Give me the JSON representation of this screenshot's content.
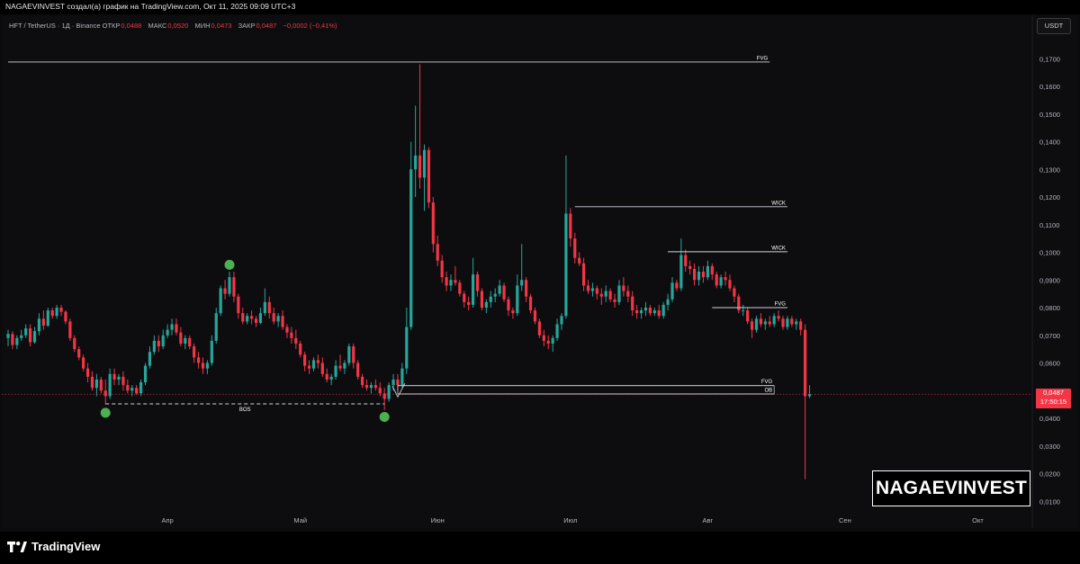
{
  "header": {
    "title": "NAGAEVINVEST создал(а) график на TradingView.com, Окт 11, 2025 09:09 UTC+3"
  },
  "symbol": {
    "name": "HFT / TetherUS · 1Д · Binance",
    "open_label": "ОТКР",
    "open_value": "0,0488",
    "high_label": "МАКС",
    "high_value": "0,0520",
    "low_label": "МИН",
    "low_value": "0,0473",
    "close_label": "ЗАКР",
    "close_value": "0,0487",
    "change": "−0,0002 (−0,41%)"
  },
  "currency_button": "USDT",
  "price_tag": {
    "price": "0,0487",
    "countdown": "17:50:15"
  },
  "watermark": "NAGAEVINVEST",
  "footer": {
    "brand": "TradingView"
  },
  "colors": {
    "up": "#26a69a",
    "down": "#f23645",
    "marker": "#4caf50",
    "background": "#0d0d10",
    "line": "#d1d4dc"
  },
  "chart_data": {
    "type": "candlestick",
    "title": "",
    "xlabel": "",
    "ylabel": "",
    "ylim": [
      0,
      0.175
    ],
    "y_ticks": [
      "0,0100",
      "0,0200",
      "0,0300",
      "0,0400",
      "0,0500",
      "0,0600",
      "0,0700",
      "0,0800",
      "0,0900",
      "0,1000",
      "0,1100",
      "0,1200",
      "0,1300",
      "0,1400",
      "0,1500",
      "0,1600",
      "0,1700"
    ],
    "y_tick_values": [
      0.01,
      0.02,
      0.03,
      0.04,
      0.05,
      0.06,
      0.07,
      0.08,
      0.09,
      0.1,
      0.11,
      0.12,
      0.13,
      0.14,
      0.15,
      0.16,
      0.17
    ],
    "x_ticks": [
      {
        "label": "Апр",
        "index": 36
      },
      {
        "label": "Май",
        "index": 66
      },
      {
        "label": "Июн",
        "index": 97
      },
      {
        "label": "Июл",
        "index": 127
      },
      {
        "label": "Авг",
        "index": 158
      },
      {
        "label": "Сен",
        "index": 189
      },
      {
        "label": "Окт",
        "index": 219
      }
    ],
    "candles": [
      [
        0.069,
        0.072,
        0.066,
        0.0705
      ],
      [
        0.0705,
        0.0715,
        0.065,
        0.0665
      ],
      [
        0.0665,
        0.07,
        0.065,
        0.069
      ],
      [
        0.069,
        0.072,
        0.068,
        0.07
      ],
      [
        0.07,
        0.074,
        0.069,
        0.0725
      ],
      [
        0.0725,
        0.074,
        0.066,
        0.0675
      ],
      [
        0.0675,
        0.073,
        0.067,
        0.0715
      ],
      [
        0.0715,
        0.078,
        0.07,
        0.076
      ],
      [
        0.076,
        0.079,
        0.072,
        0.0735
      ],
      [
        0.0735,
        0.08,
        0.073,
        0.079
      ],
      [
        0.079,
        0.08,
        0.076,
        0.077
      ],
      [
        0.077,
        0.081,
        0.076,
        0.08
      ],
      [
        0.08,
        0.081,
        0.077,
        0.0785
      ],
      [
        0.0785,
        0.079,
        0.074,
        0.075
      ],
      [
        0.075,
        0.076,
        0.068,
        0.069
      ],
      [
        0.069,
        0.07,
        0.064,
        0.065
      ],
      [
        0.065,
        0.066,
        0.061,
        0.062
      ],
      [
        0.062,
        0.063,
        0.057,
        0.058
      ],
      [
        0.058,
        0.06,
        0.053,
        0.055
      ],
      [
        0.055,
        0.057,
        0.05,
        0.051
      ],
      [
        0.051,
        0.056,
        0.048,
        0.054
      ],
      [
        0.054,
        0.055,
        0.049,
        0.05
      ],
      [
        0.05,
        0.054,
        0.045,
        0.048
      ],
      [
        0.048,
        0.058,
        0.047,
        0.056
      ],
      [
        0.056,
        0.058,
        0.052,
        0.054
      ],
      [
        0.054,
        0.056,
        0.052,
        0.055
      ],
      [
        0.055,
        0.057,
        0.05,
        0.052
      ],
      [
        0.052,
        0.054,
        0.049,
        0.05
      ],
      [
        0.05,
        0.052,
        0.048,
        0.051
      ],
      [
        0.051,
        0.052,
        0.0485,
        0.049
      ],
      [
        0.049,
        0.054,
        0.048,
        0.053
      ],
      [
        0.053,
        0.06,
        0.052,
        0.059
      ],
      [
        0.059,
        0.066,
        0.058,
        0.064
      ],
      [
        0.064,
        0.07,
        0.063,
        0.068
      ],
      [
        0.068,
        0.07,
        0.064,
        0.066
      ],
      [
        0.066,
        0.072,
        0.065,
        0.07
      ],
      [
        0.07,
        0.074,
        0.069,
        0.072
      ],
      [
        0.072,
        0.076,
        0.07,
        0.074
      ],
      [
        0.074,
        0.076,
        0.07,
        0.071
      ],
      [
        0.071,
        0.073,
        0.066,
        0.067
      ],
      [
        0.067,
        0.07,
        0.065,
        0.069
      ],
      [
        0.069,
        0.07,
        0.065,
        0.066
      ],
      [
        0.066,
        0.067,
        0.06,
        0.062
      ],
      [
        0.062,
        0.064,
        0.058,
        0.06
      ],
      [
        0.06,
        0.062,
        0.056,
        0.058
      ],
      [
        0.058,
        0.061,
        0.056,
        0.06
      ],
      [
        0.06,
        0.07,
        0.059,
        0.068
      ],
      [
        0.068,
        0.08,
        0.067,
        0.078
      ],
      [
        0.078,
        0.088,
        0.077,
        0.087
      ],
      [
        0.087,
        0.09,
        0.083,
        0.085
      ],
      [
        0.085,
        0.093,
        0.084,
        0.091
      ],
      [
        0.091,
        0.093,
        0.082,
        0.084
      ],
      [
        0.084,
        0.085,
        0.076,
        0.078
      ],
      [
        0.078,
        0.08,
        0.074,
        0.075
      ],
      [
        0.075,
        0.078,
        0.074,
        0.077
      ],
      [
        0.077,
        0.079,
        0.074,
        0.076
      ],
      [
        0.076,
        0.077,
        0.073,
        0.0745
      ],
      [
        0.0745,
        0.08,
        0.074,
        0.078
      ],
      [
        0.078,
        0.087,
        0.077,
        0.082
      ],
      [
        0.082,
        0.084,
        0.076,
        0.078
      ],
      [
        0.078,
        0.08,
        0.074,
        0.075
      ],
      [
        0.075,
        0.078,
        0.073,
        0.077
      ],
      [
        0.077,
        0.079,
        0.072,
        0.073
      ],
      [
        0.073,
        0.074,
        0.069,
        0.071
      ],
      [
        0.071,
        0.073,
        0.067,
        0.069
      ],
      [
        0.069,
        0.072,
        0.065,
        0.067
      ],
      [
        0.067,
        0.068,
        0.062,
        0.063
      ],
      [
        0.063,
        0.064,
        0.057,
        0.059
      ],
      [
        0.059,
        0.061,
        0.056,
        0.058
      ],
      [
        0.058,
        0.062,
        0.057,
        0.061
      ],
      [
        0.061,
        0.063,
        0.058,
        0.06
      ],
      [
        0.06,
        0.062,
        0.055,
        0.056
      ],
      [
        0.056,
        0.058,
        0.053,
        0.054
      ],
      [
        0.054,
        0.056,
        0.052,
        0.055
      ],
      [
        0.055,
        0.061,
        0.054,
        0.059
      ],
      [
        0.059,
        0.063,
        0.057,
        0.058
      ],
      [
        0.058,
        0.061,
        0.056,
        0.06
      ],
      [
        0.06,
        0.067,
        0.059,
        0.066
      ],
      [
        0.066,
        0.067,
        0.058,
        0.06
      ],
      [
        0.06,
        0.061,
        0.054,
        0.055
      ],
      [
        0.055,
        0.056,
        0.051,
        0.052
      ],
      [
        0.052,
        0.054,
        0.05,
        0.051
      ],
      [
        0.051,
        0.053,
        0.049,
        0.052
      ],
      [
        0.052,
        0.054,
        0.05,
        0.051
      ],
      [
        0.051,
        0.053,
        0.048,
        0.049
      ],
      [
        0.049,
        0.051,
        0.043,
        0.047
      ],
      [
        0.047,
        0.053,
        0.046,
        0.052
      ],
      [
        0.052,
        0.056,
        0.05,
        0.054
      ],
      [
        0.054,
        0.056,
        0.05,
        0.052
      ],
      [
        0.052,
        0.06,
        0.051,
        0.058
      ],
      [
        0.058,
        0.08,
        0.056,
        0.073
      ],
      [
        0.073,
        0.14,
        0.072,
        0.13
      ],
      [
        0.13,
        0.153,
        0.12,
        0.135
      ],
      [
        0.135,
        0.168,
        0.123,
        0.127
      ],
      [
        0.127,
        0.139,
        0.115,
        0.137
      ],
      [
        0.137,
        0.138,
        0.116,
        0.118
      ],
      [
        0.118,
        0.12,
        0.1,
        0.103
      ],
      [
        0.103,
        0.106,
        0.095,
        0.097
      ],
      [
        0.097,
        0.099,
        0.089,
        0.091
      ],
      [
        0.091,
        0.093,
        0.086,
        0.088
      ],
      [
        0.088,
        0.092,
        0.086,
        0.09
      ],
      [
        0.09,
        0.095,
        0.088,
        0.089
      ],
      [
        0.089,
        0.09,
        0.084,
        0.085
      ],
      [
        0.085,
        0.086,
        0.08,
        0.082
      ],
      [
        0.082,
        0.084,
        0.079,
        0.081
      ],
      [
        0.081,
        0.098,
        0.08,
        0.092
      ],
      [
        0.092,
        0.093,
        0.084,
        0.086
      ],
      [
        0.086,
        0.087,
        0.079,
        0.08
      ],
      [
        0.08,
        0.083,
        0.078,
        0.082
      ],
      [
        0.082,
        0.086,
        0.08,
        0.084
      ],
      [
        0.084,
        0.087,
        0.082,
        0.085
      ],
      [
        0.085,
        0.09,
        0.084,
        0.088
      ],
      [
        0.088,
        0.089,
        0.082,
        0.083
      ],
      [
        0.083,
        0.084,
        0.077,
        0.079
      ],
      [
        0.079,
        0.08,
        0.076,
        0.078
      ],
      [
        0.078,
        0.092,
        0.077,
        0.088
      ],
      [
        0.088,
        0.103,
        0.086,
        0.09
      ],
      [
        0.09,
        0.091,
        0.082,
        0.084
      ],
      [
        0.084,
        0.085,
        0.078,
        0.079
      ],
      [
        0.079,
        0.08,
        0.074,
        0.075
      ],
      [
        0.075,
        0.076,
        0.069,
        0.07
      ],
      [
        0.07,
        0.072,
        0.066,
        0.068
      ],
      [
        0.068,
        0.07,
        0.065,
        0.067
      ],
      [
        0.067,
        0.07,
        0.064,
        0.069
      ],
      [
        0.069,
        0.076,
        0.068,
        0.074
      ],
      [
        0.074,
        0.078,
        0.072,
        0.077
      ],
      [
        0.077,
        0.135,
        0.076,
        0.114
      ],
      [
        0.114,
        0.116,
        0.102,
        0.105
      ],
      [
        0.105,
        0.107,
        0.096,
        0.098
      ],
      [
        0.098,
        0.1,
        0.095,
        0.096
      ],
      [
        0.096,
        0.098,
        0.086,
        0.088
      ],
      [
        0.088,
        0.09,
        0.085,
        0.086
      ],
      [
        0.086,
        0.089,
        0.084,
        0.087
      ],
      [
        0.087,
        0.088,
        0.083,
        0.085
      ],
      [
        0.085,
        0.087,
        0.081,
        0.084
      ],
      [
        0.084,
        0.088,
        0.082,
        0.086
      ],
      [
        0.086,
        0.087,
        0.082,
        0.083
      ],
      [
        0.083,
        0.085,
        0.08,
        0.082
      ],
      [
        0.082,
        0.09,
        0.081,
        0.088
      ],
      [
        0.088,
        0.091,
        0.084,
        0.086
      ],
      [
        0.086,
        0.088,
        0.082,
        0.084
      ],
      [
        0.084,
        0.086,
        0.077,
        0.079
      ],
      [
        0.079,
        0.081,
        0.076,
        0.078
      ],
      [
        0.078,
        0.08,
        0.076,
        0.079
      ],
      [
        0.079,
        0.082,
        0.077,
        0.08
      ],
      [
        0.08,
        0.081,
        0.077,
        0.078
      ],
      [
        0.078,
        0.08,
        0.077,
        0.079
      ],
      [
        0.079,
        0.081,
        0.076,
        0.077
      ],
      [
        0.077,
        0.082,
        0.076,
        0.081
      ],
      [
        0.081,
        0.085,
        0.079,
        0.083
      ],
      [
        0.083,
        0.091,
        0.082,
        0.089
      ],
      [
        0.089,
        0.09,
        0.086,
        0.087
      ],
      [
        0.087,
        0.105,
        0.086,
        0.099
      ],
      [
        0.099,
        0.101,
        0.093,
        0.095
      ],
      [
        0.095,
        0.097,
        0.092,
        0.094
      ],
      [
        0.094,
        0.096,
        0.088,
        0.09
      ],
      [
        0.09,
        0.095,
        0.088,
        0.093
      ],
      [
        0.093,
        0.095,
        0.089,
        0.091
      ],
      [
        0.091,
        0.097,
        0.09,
        0.095
      ],
      [
        0.095,
        0.096,
        0.09,
        0.092
      ],
      [
        0.092,
        0.093,
        0.087,
        0.088
      ],
      [
        0.088,
        0.092,
        0.087,
        0.091
      ],
      [
        0.091,
        0.093,
        0.088,
        0.09
      ],
      [
        0.09,
        0.092,
        0.086,
        0.087
      ],
      [
        0.087,
        0.088,
        0.082,
        0.084
      ],
      [
        0.084,
        0.085,
        0.078,
        0.079
      ],
      [
        0.079,
        0.081,
        0.077,
        0.079
      ],
      [
        0.079,
        0.08,
        0.074,
        0.075
      ],
      [
        0.075,
        0.076,
        0.069,
        0.072
      ],
      [
        0.072,
        0.077,
        0.071,
        0.076
      ],
      [
        0.076,
        0.078,
        0.073,
        0.074
      ],
      [
        0.074,
        0.076,
        0.072,
        0.075
      ],
      [
        0.075,
        0.077,
        0.073,
        0.074
      ],
      [
        0.074,
        0.078,
        0.073,
        0.077
      ],
      [
        0.077,
        0.079,
        0.075,
        0.076
      ],
      [
        0.076,
        0.077,
        0.072,
        0.073
      ],
      [
        0.073,
        0.077,
        0.072,
        0.076
      ],
      [
        0.076,
        0.077,
        0.073,
        0.074
      ],
      [
        0.074,
        0.076,
        0.072,
        0.075
      ],
      [
        0.075,
        0.076,
        0.07,
        0.072
      ],
      [
        0.072,
        0.074,
        0.018,
        0.048
      ],
      [
        0.048,
        0.052,
        0.0473,
        0.0487
      ]
    ],
    "markers": [
      {
        "index": 22,
        "price": 0.042
      },
      {
        "index": 50,
        "price": 0.0955
      },
      {
        "index": 85,
        "price": 0.0405
      }
    ],
    "levels": [
      {
        "label": "FVG",
        "price": 0.1688,
        "from": 0,
        "to": 172
      },
      {
        "label": "WICK",
        "price": 0.1165,
        "from": 128,
        "to": 176
      },
      {
        "label": "WICK",
        "price": 0.1002,
        "from": 149,
        "to": 176
      },
      {
        "label": "FVG",
        "price": 0.08,
        "from": 159,
        "to": 176
      },
      {
        "label": "FVG",
        "price": 0.0518,
        "from": 88,
        "to": 173
      },
      {
        "label": "OB",
        "price": 0.0488,
        "from": 88,
        "to": 173
      },
      {
        "label": "BOS",
        "price": 0.0452,
        "from": 22,
        "to": 85,
        "dashed": true
      }
    ]
  }
}
